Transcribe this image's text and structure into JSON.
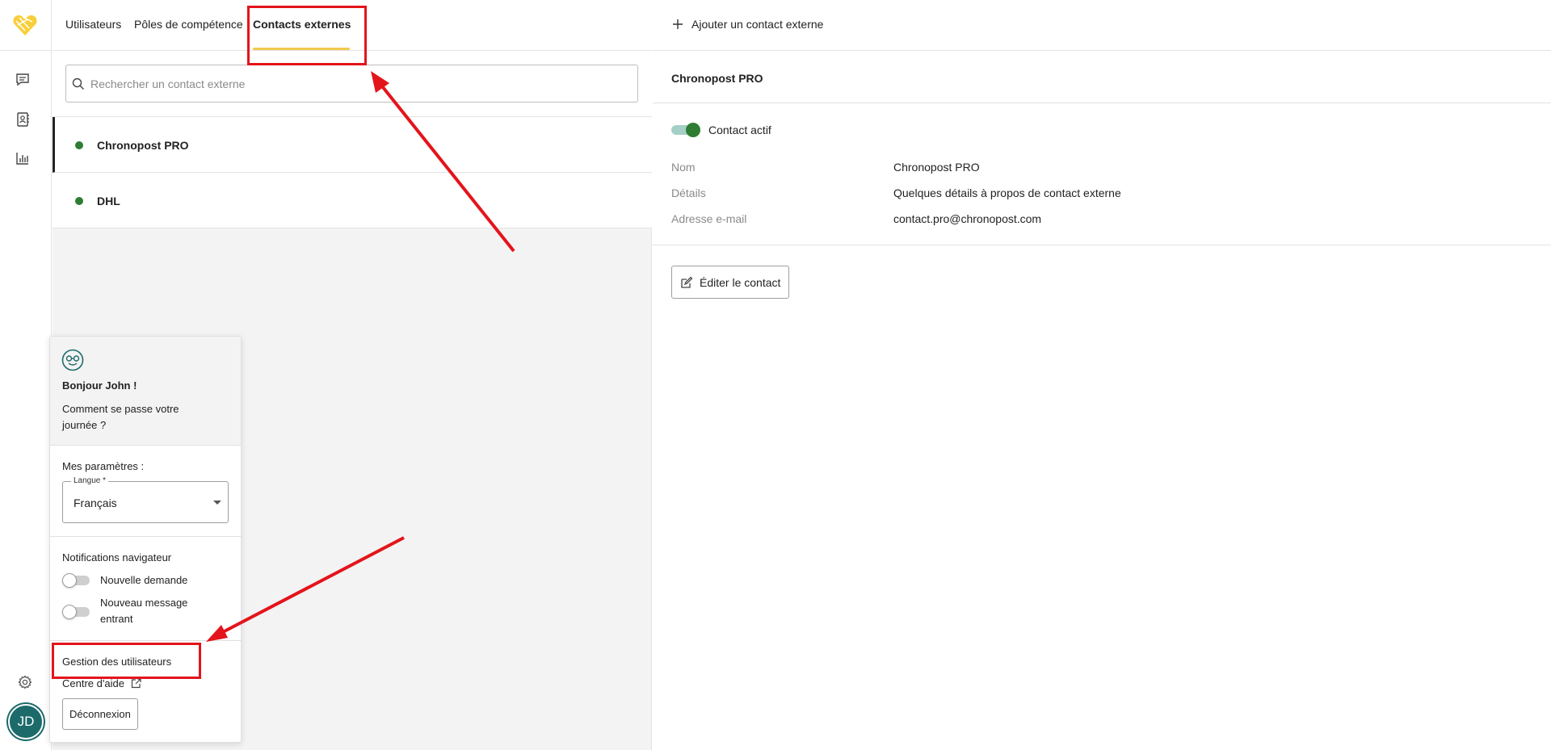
{
  "tabs": [
    {
      "label": "Utilisateurs"
    },
    {
      "label": "Pôles de compétence"
    },
    {
      "label": "Contacts externes"
    }
  ],
  "search": {
    "placeholder": "Rechercher un contact externe"
  },
  "contacts": [
    {
      "name": "Chronopost PRO",
      "status_color": "#2e7d32"
    },
    {
      "name": "DHL",
      "status_color": "#2e7d32"
    }
  ],
  "add_contact_label": "Ajouter un contact externe",
  "detail": {
    "title": "Chronopost PRO",
    "active_label": "Contact actif",
    "fields": [
      {
        "label": "Nom",
        "value": "Chronopost PRO"
      },
      {
        "label": "Détails",
        "value": "Quelques détails à propos de contact externe"
      },
      {
        "label": "Adresse e-mail",
        "value": "contact.pro@chronopost.com"
      }
    ],
    "edit_label": "Éditer le contact"
  },
  "popup": {
    "greeting": "Bonjour John !",
    "question": "Comment se passe votre journée ?",
    "params_label": "Mes paramètres :",
    "language_legend": "Langue *",
    "language_value": "Français",
    "notifications_label": "Notifications navigateur",
    "toggles": [
      {
        "label": "Nouvelle demande"
      },
      {
        "label": "Nouveau message entrant"
      }
    ],
    "user_mgmt": "Gestion des utilisateurs",
    "help": "Centre d'aide",
    "logout": "Déconnexion"
  },
  "avatar_initials": "JD",
  "colors": {
    "accent_underline": "#f2c94c",
    "status_green": "#2e7d32",
    "annotation_red": "#e4141b",
    "avatar_teal": "#1c6b6a"
  }
}
